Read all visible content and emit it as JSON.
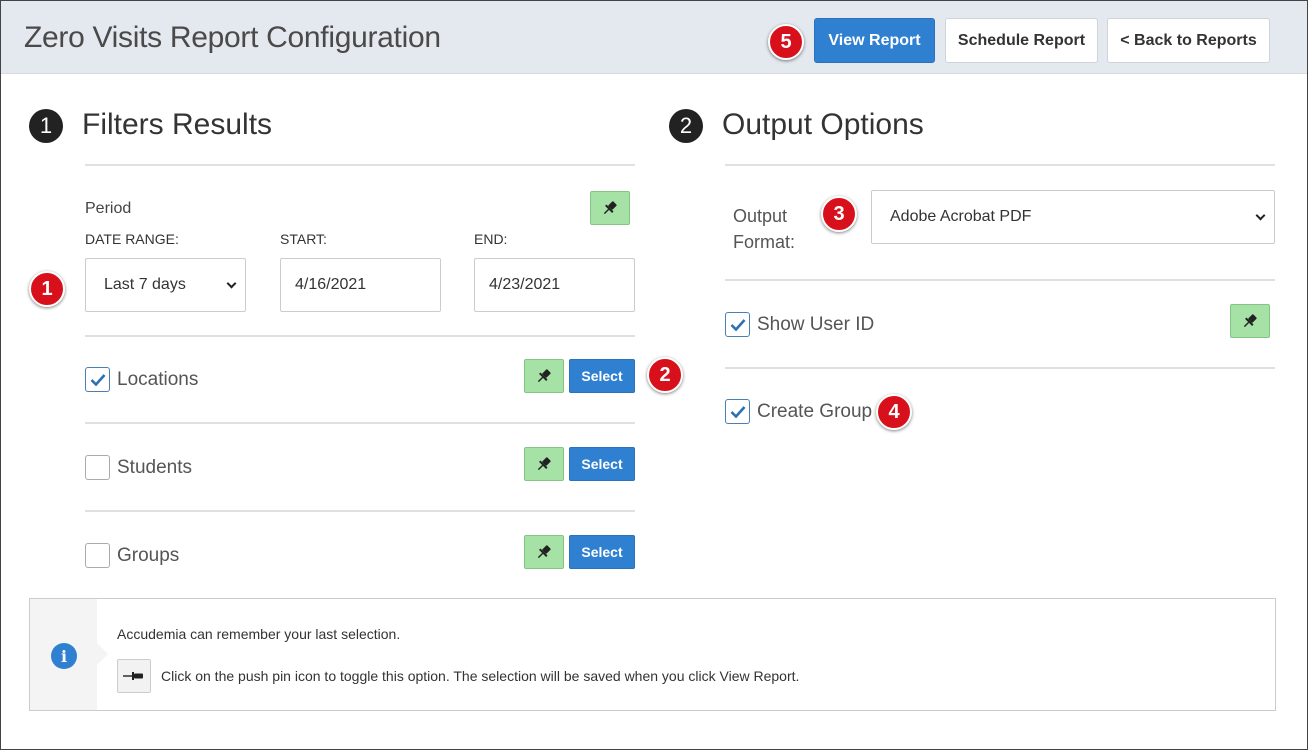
{
  "header": {
    "title": "Zero Visits Report Configuration",
    "view_report_label": "View Report",
    "schedule_report_label": "Schedule Report",
    "back_label": "< Back to Reports"
  },
  "badges": {
    "b1": "1",
    "b2": "2",
    "b3": "3",
    "b4": "4",
    "b5": "5"
  },
  "filters": {
    "step": "1",
    "title": "Filters Results",
    "period_label": "Period",
    "date_range_label": "DATE RANGE:",
    "start_label": "START:",
    "end_label": "END:",
    "date_range_value": "Last 7 days",
    "start_value": "4/16/2021",
    "end_value": "4/23/2021",
    "items": [
      {
        "label": "Locations",
        "checked": true,
        "select_label": "Select"
      },
      {
        "label": "Students",
        "checked": false,
        "select_label": "Select"
      },
      {
        "label": "Groups",
        "checked": false,
        "select_label": "Select"
      }
    ]
  },
  "output": {
    "step": "2",
    "title": "Output Options",
    "format_label_line1": "Output",
    "format_label_line2": "Format:",
    "format_value": "Adobe Acrobat PDF",
    "show_user_id_label": "Show User ID",
    "show_user_id_checked": true,
    "create_group_label": "Create Group",
    "create_group_checked": true
  },
  "info": {
    "line1": "Accudemia can remember your last selection.",
    "line2": "Click on the push pin icon to toggle this option. The selection will be saved when you click View Report."
  },
  "colors": {
    "primary": "#2f80d1",
    "badge_red": "#d8101c",
    "pin_green": "#a6e2a6",
    "header_bg": "#e4e8ef"
  }
}
